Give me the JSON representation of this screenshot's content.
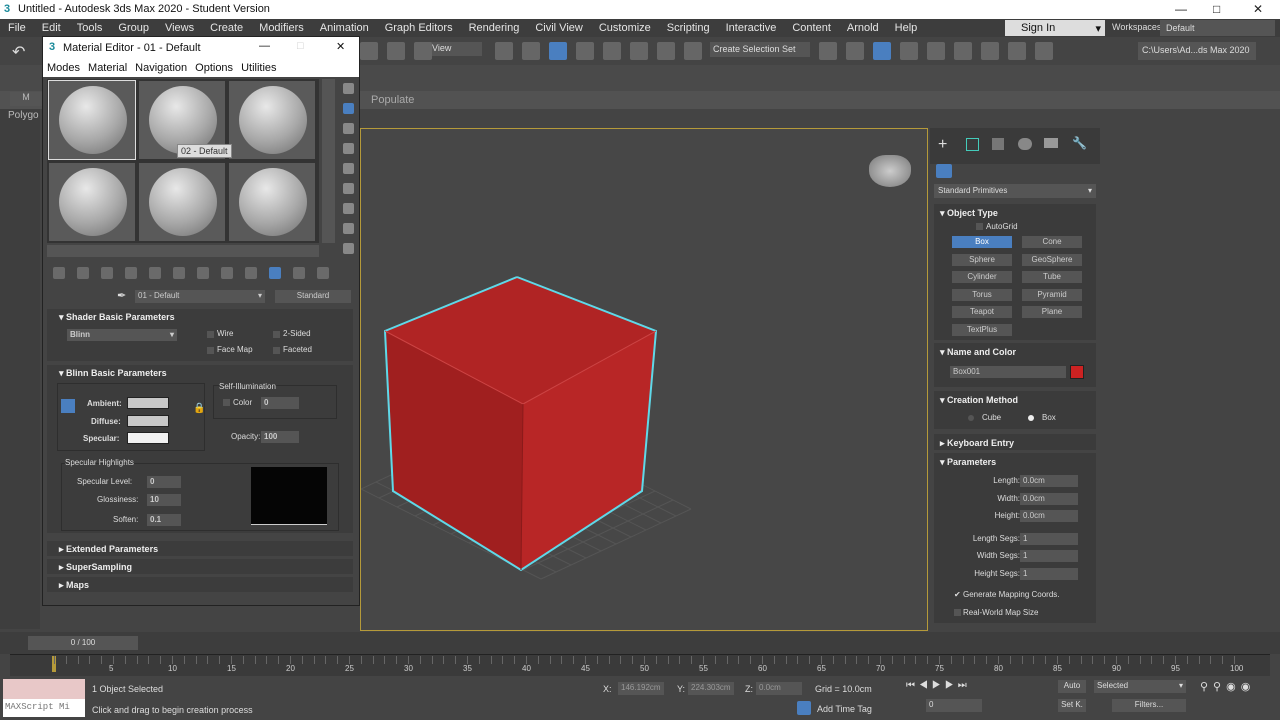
{
  "app": {
    "title": "Untitled - Autodesk 3ds Max 2020 - Student Version"
  },
  "menu": [
    "File",
    "Edit",
    "Tools",
    "Group",
    "Views",
    "Create",
    "Modifiers",
    "Animation",
    "Graph Editors",
    "Rendering",
    "Civil View",
    "Customize",
    "Scripting",
    "Interactive",
    "Content",
    "Arnold",
    "Help"
  ],
  "toolbar": {
    "view": "View",
    "selection_set": "Create Selection Set",
    "sign_in": "Sign In",
    "workspaces_label": "Workspaces:",
    "workspace": "Default",
    "project_path": "C:\\Users\\Ad...ds Max 2020"
  },
  "ribbon": {
    "populate": "Populate",
    "left_tab": "M",
    "polygon": "Polygo"
  },
  "material_editor": {
    "title": "Material Editor - 01 - Default",
    "menu": [
      "Modes",
      "Material",
      "Navigation",
      "Options",
      "Utilities"
    ],
    "tooltip": "02 - Default",
    "material_name": "01 - Default",
    "material_type": "Standard",
    "shader_section": "Shader Basic Parameters",
    "shader": "Blinn",
    "checks": [
      "Wire",
      "2-Sided",
      "Face Map",
      "Faceted"
    ],
    "blinn_section": "Blinn Basic Parameters",
    "ambient": "Ambient:",
    "diffuse": "Diffuse:",
    "specular": "Specular:",
    "self_illum": "Self-Illumination",
    "color_label": "Color",
    "color_value": "0",
    "opacity_label": "Opacity:",
    "opacity": "100",
    "spec_highlights": "Specular Highlights",
    "spec_level_label": "Specular Level:",
    "spec_level": "0",
    "gloss_label": "Glossiness:",
    "gloss": "10",
    "soften_label": "Soften:",
    "soften": "0.1",
    "collapsed": [
      "Extended Parameters",
      "SuperSampling",
      "Maps"
    ],
    "colors": {
      "ambient": "#c8c8c8",
      "diffuse": "#c8c8c8",
      "specular": "#f2f2f2"
    }
  },
  "command_panel": {
    "category": "Standard Primitives",
    "object_type": "Object Type",
    "autogrid": "AutoGrid",
    "primitives": [
      "Box",
      "Cone",
      "Sphere",
      "GeoSphere",
      "Cylinder",
      "Tube",
      "Torus",
      "Pyramid",
      "Teapot",
      "Plane",
      "TextPlus"
    ],
    "active_primitive": "Box",
    "name_color": "Name and Color",
    "object_name": "Box001",
    "object_color": "#cc2222",
    "creation_method": "Creation Method",
    "cube": "Cube",
    "box": "Box",
    "selected_method": "Box",
    "keyboard_entry": "Keyboard Entry",
    "parameters": "Parameters",
    "params": [
      {
        "label": "Length:",
        "value": "0.0cm"
      },
      {
        "label": "Width:",
        "value": "0.0cm"
      },
      {
        "label": "Height:",
        "value": "0.0cm"
      },
      {
        "label": "Length Segs:",
        "value": "1"
      },
      {
        "label": "Width Segs:",
        "value": "1"
      },
      {
        "label": "Height Segs:",
        "value": "1"
      }
    ],
    "gen_mapping": "Generate Mapping Coords.",
    "gen_mapping_checked": true,
    "real_world": "Real-World Map Size",
    "real_world_checked": false
  },
  "viewport": {
    "cube_color": "#b02424",
    "selection_color": "#5fd8e8"
  },
  "timeline": {
    "frame": "0 / 100",
    "ticks": [
      "5",
      "10",
      "15",
      "20",
      "25",
      "30",
      "35",
      "40",
      "45",
      "50",
      "55",
      "60",
      "65",
      "70",
      "75",
      "80",
      "85",
      "90",
      "95",
      "100"
    ]
  },
  "status": {
    "selected": "1 Object Selected",
    "prompt": "Click and drag to begin creation process",
    "maxscript": "MAXScript Mi",
    "x_label": "X:",
    "x": "146.192cm",
    "y_label": "Y:",
    "y": "224.303cm",
    "z_label": "Z:",
    "z": "0.0cm",
    "grid": "Grid = 10.0cm",
    "add_time_tag": "Add Time Tag",
    "auto": "Auto",
    "set_key": "Set K.",
    "key_mode": "Selected",
    "filters": "Filters...",
    "current_frame": "0"
  }
}
